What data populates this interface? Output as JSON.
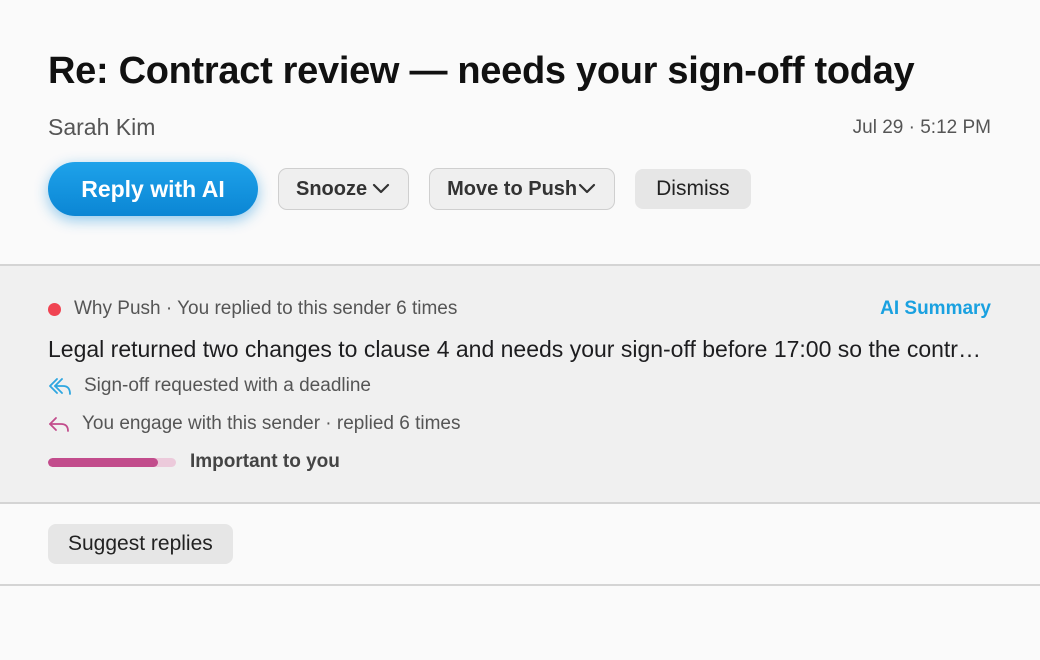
{
  "email": {
    "subject": "Re: Contract review — needs your sign-off today",
    "sender": "Sarah Kim",
    "timestamp": "Jul 29 · 5:12 PM"
  },
  "actions": {
    "reply_ai_label": "Reply with AI",
    "snooze_label": "Snooze",
    "move_label": "Move to Push",
    "dismiss_label": "Dismiss"
  },
  "push_panel": {
    "why_push": "Why Push · You replied to this sender 6 times",
    "ai_summary_label": "AI Summary",
    "summary": "Legal returned two changes to clause 4 and needs your sign-off before 17:00 so the contract can go out today.",
    "reasons": [
      {
        "icon": "reply-all-icon",
        "text": "Sign-off requested with a deadline",
        "color": "#2ea6e0"
      },
      {
        "icon": "reply-icon",
        "text": "You engage with this sender · replied 6 times",
        "color": "#c24c8c"
      }
    ],
    "importance_label": "Important to you",
    "importance_level": 0.86,
    "colors": {
      "dot": "#f04452",
      "bar_fill": "#c24c8c",
      "bar_track": "#eccadb",
      "accent": "#1aa1e0"
    }
  },
  "suggest": {
    "label": "Suggest replies"
  }
}
